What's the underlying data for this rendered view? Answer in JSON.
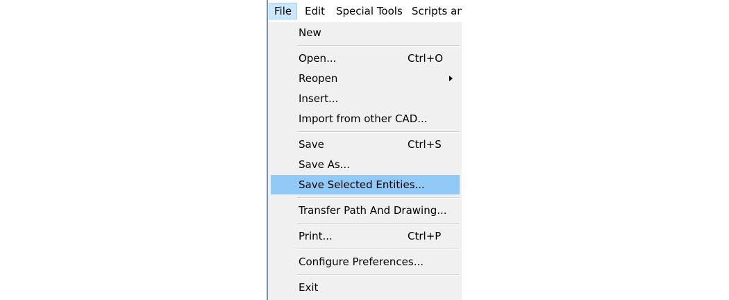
{
  "menubar": {
    "items": [
      {
        "label": "File"
      },
      {
        "label": "Edit"
      },
      {
        "label": "Special Tools"
      },
      {
        "label": "Scripts and"
      }
    ]
  },
  "file_menu": {
    "items": [
      {
        "label": "New",
        "shortcut": ""
      },
      {
        "label": "Open...",
        "shortcut": "Ctrl+O"
      },
      {
        "label": "Reopen",
        "shortcut": "",
        "has_submenu": true
      },
      {
        "label": "Insert...",
        "shortcut": ""
      },
      {
        "label": "Import from other CAD...",
        "shortcut": ""
      },
      {
        "label": "Save",
        "shortcut": "Ctrl+S"
      },
      {
        "label": "Save As...",
        "shortcut": ""
      },
      {
        "label": "Save Selected Entities...",
        "shortcut": "",
        "highlighted": true
      },
      {
        "label": "Transfer Path And Drawing...",
        "shortcut": ""
      },
      {
        "label": "Print...",
        "shortcut": "Ctrl+P"
      },
      {
        "label": "Configure Preferences...",
        "shortcut": ""
      },
      {
        "label": "Exit",
        "shortcut": ""
      }
    ]
  },
  "colors": {
    "menu_background": "#f0f0f0",
    "highlight": "#91c9f7",
    "menubar_active": "#cce8ff",
    "window_edge": "#6f8fb5"
  }
}
